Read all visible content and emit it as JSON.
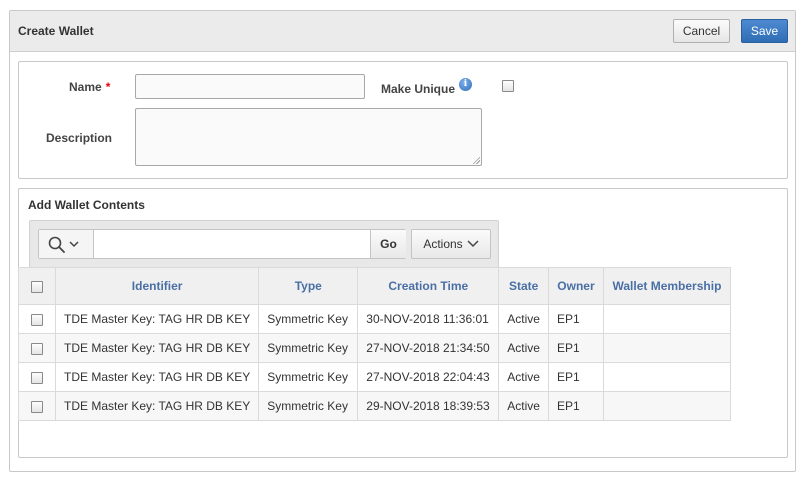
{
  "dialog": {
    "title": "Create Wallet",
    "cancel_label": "Cancel",
    "save_label": "Save"
  },
  "form": {
    "name_label": "Name",
    "required_marker": "*",
    "name_value": "",
    "make_unique_label": "Make Unique",
    "make_unique_checked": false,
    "description_label": "Description",
    "description_value": ""
  },
  "contents": {
    "title": "Add Wallet Contents",
    "search_value": "",
    "go_label": "Go",
    "actions_label": "Actions",
    "columns": [
      "Identifier",
      "Type",
      "Creation Time",
      "State",
      "Owner",
      "Wallet Membership"
    ],
    "rows": [
      {
        "identifier": "TDE Master Key: TAG HR DB KEY",
        "type": "Symmetric Key",
        "creation_time": "30-NOV-2018 11:36:01",
        "state": "Active",
        "owner": "EP1",
        "membership": ""
      },
      {
        "identifier": "TDE Master Key: TAG HR DB KEY",
        "type": "Symmetric Key",
        "creation_time": "27-NOV-2018 21:34:50",
        "state": "Active",
        "owner": "EP1",
        "membership": ""
      },
      {
        "identifier": "TDE Master Key: TAG HR DB KEY",
        "type": "Symmetric Key",
        "creation_time": "27-NOV-2018 22:04:43",
        "state": "Active",
        "owner": "EP1",
        "membership": ""
      },
      {
        "identifier": "TDE Master Key: TAG HR DB KEY",
        "type": "Symmetric Key",
        "creation_time": "29-NOV-2018 18:39:53",
        "state": "Active",
        "owner": "EP1",
        "membership": ""
      }
    ]
  },
  "icons": {
    "search": "search-icon",
    "chevron": "chevron-down-icon",
    "info": "info-icon"
  },
  "colors": {
    "save_button": "#2f6db5",
    "header_text": "#4a6fa5",
    "required": "#ee0000"
  }
}
